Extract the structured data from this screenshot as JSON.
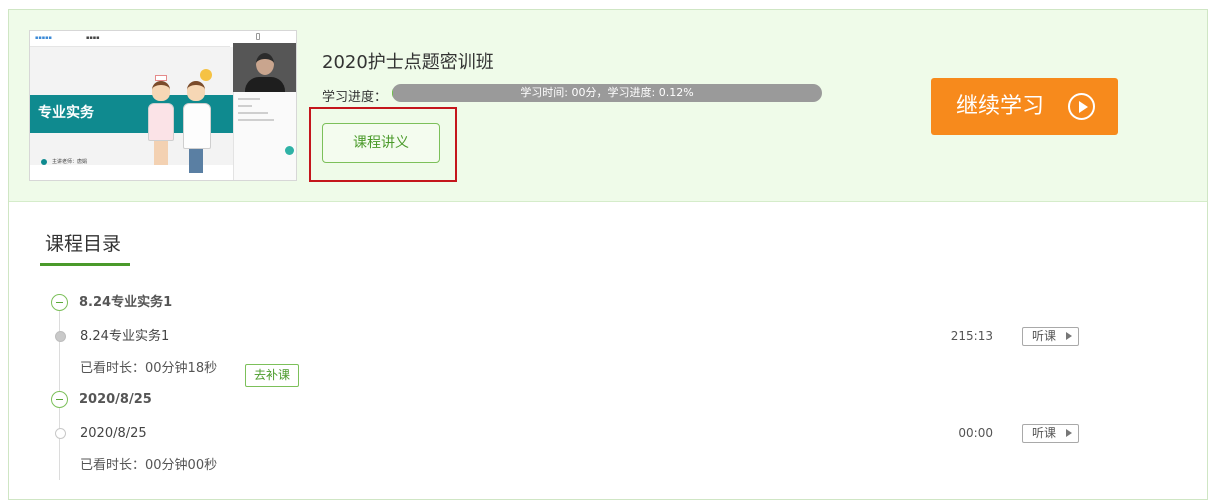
{
  "course": {
    "title": "2020护士点题密训班",
    "progress_label": "学习进度：",
    "progress_text": "学习时间: 00分，学习进度: 0.12%",
    "progress_percent": 0.12,
    "notes_button": "课程讲义",
    "continue_button": "继续学习",
    "thumbnail": {
      "subject": "专业实务",
      "teacher": "主讲老师：唐娟"
    }
  },
  "catalog": {
    "title": "课程目录",
    "chapters": [
      {
        "title": "8.24专业实务1",
        "lessons": [
          {
            "name": "8.24专业实务1",
            "duration": "215:13",
            "listen_label": "听课",
            "watched": "已看时长：00分钟18秒",
            "makeup_label": "去补课"
          }
        ]
      },
      {
        "title": "2020/8/25",
        "lessons": [
          {
            "name": "2020/8/25",
            "duration": "00:00",
            "listen_label": "听课",
            "watched": "已看时长：00分钟00秒"
          }
        ]
      }
    ]
  },
  "colors": {
    "accent_green": "#4a9a2a",
    "card_background": "#effbe9",
    "continue_orange": "#f78a1c",
    "highlight_red": "#c4161c",
    "progress_gray": "#9a9a9a"
  },
  "icons": [
    "play-circle-icon",
    "collapse-minus-icon",
    "play-arrow-icon",
    "timeline-node-icon"
  ]
}
